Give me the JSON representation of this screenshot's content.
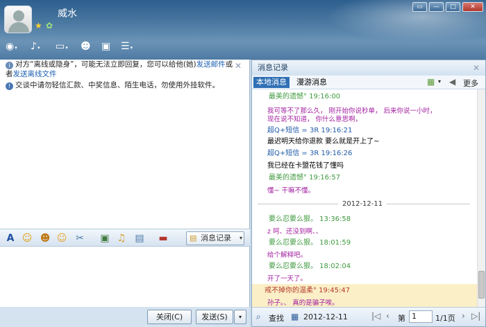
{
  "window": {
    "contact_name": "威水"
  },
  "notices": {
    "n1_a": "对方“离线或隐身”，可能无法立即回复，您可以给他(她)",
    "n1_link1": "发送邮件",
    "n1_b": "或者",
    "n1_link2": "发送离线文件",
    "n2": "交谈中请勿轻信汇款、中奖信息、陌生电话，勿使用外挂软件。"
  },
  "fmtbar": {
    "history_label": "消息记录"
  },
  "bottom": {
    "close_label": "关闭(C)",
    "send_label": "发送(S)"
  },
  "history": {
    "title": "消息记录",
    "tab_local": "本地消息",
    "tab_roam": "漫游消息",
    "more_label": "更多",
    "messages": [
      {
        "c": "sd",
        "t": "最美的遗憾°  19:16:00"
      },
      {
        "c": "pu",
        "t": "我可等不了那么久，  刚开始你说秒单，  后来你说一小时，"
      },
      {
        "c": "pu",
        "t": "现在说不知道，  你什么意思啊，"
      },
      {
        "c": "gr",
        "t": "超Q+短信 = 3R   19:16:21"
      },
      {
        "c": "bk",
        "t": "最迟明天给你退款 要么就是开上了~"
      },
      {
        "c": "gr",
        "t": "超Q+短信 = 3R   19:16:26"
      },
      {
        "c": "bk",
        "t": "我已经在卡盟花钱了懂吗"
      },
      {
        "c": "sd",
        "t": "最美的遗憾°  19:16:57"
      },
      {
        "c": "pu",
        "t": "懂~ 干嘛不懂。"
      },
      {
        "c": "date",
        "t": "2012-12-11"
      },
      {
        "c": "sd",
        "t": "要么忍要么狠。  13:36:58"
      },
      {
        "c": "pu",
        "t": "z      呵、还没到啊、、"
      },
      {
        "c": "sd",
        "t": "要么忍要么狠。  18:01:59"
      },
      {
        "c": "pu",
        "t": "给个解释吧。"
      },
      {
        "c": "sd",
        "t": "要么忍要么狠。  18:02:04"
      },
      {
        "c": "pu",
        "t": "开了一天了。"
      },
      {
        "c": "hl",
        "t": "戒不掉你的温柔°  19:45:47"
      },
      {
        "c": "hlp",
        "t": "孙子。、 真的是骗子唉。"
      }
    ],
    "find_label": "查找",
    "date_value": "2012-12-11",
    "page_prefix": "第",
    "page_value": "1",
    "page_suffix": "1/1页"
  }
}
